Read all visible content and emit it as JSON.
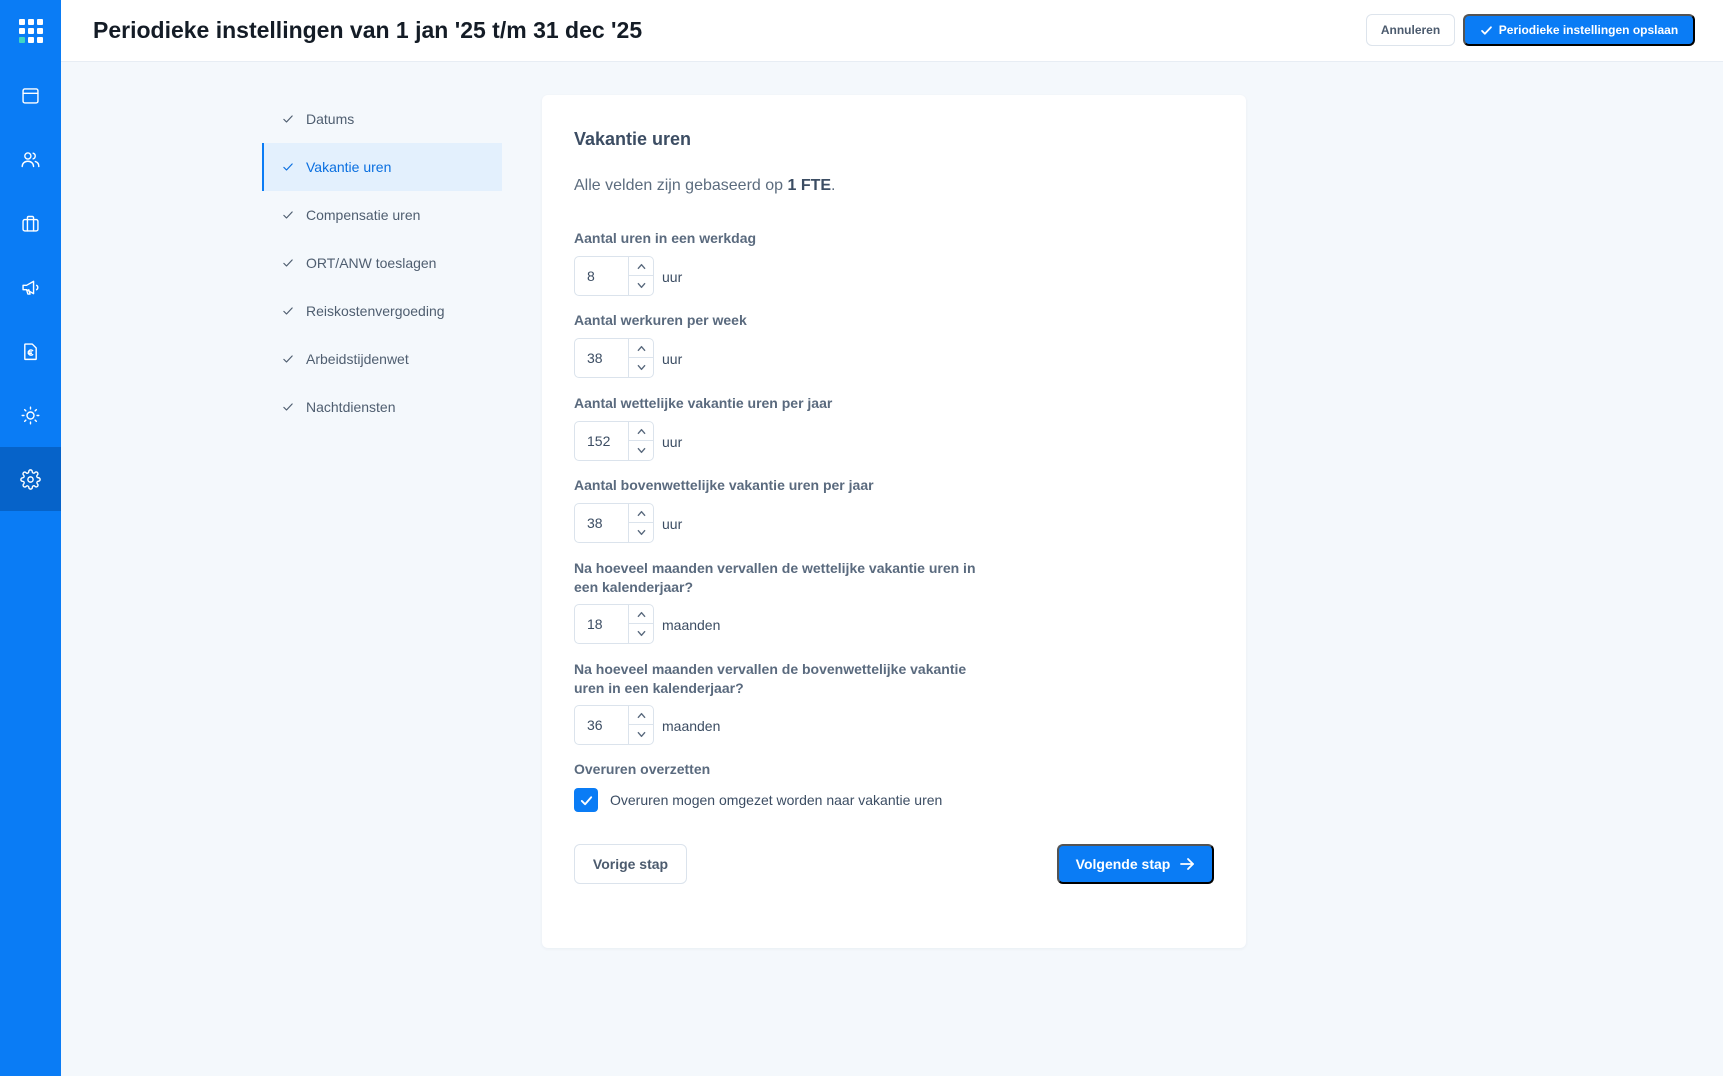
{
  "header": {
    "title": "Periodieke instellingen van 1 jan '25 t/m 31 dec '25",
    "cancel_label": "Annuleren",
    "save_label": "Periodieke instellingen opslaan"
  },
  "rail": {
    "items": [
      {
        "icon": "calendar-icon"
      },
      {
        "icon": "users-icon"
      },
      {
        "icon": "briefcase-icon"
      },
      {
        "icon": "megaphone-icon"
      },
      {
        "icon": "euro-document-icon"
      },
      {
        "icon": "sun-icon"
      },
      {
        "icon": "gear-icon",
        "active": true
      }
    ],
    "colors": {
      "background": "#0a7cf5",
      "active": "#0663c9"
    }
  },
  "steps": [
    {
      "label": "Datums"
    },
    {
      "label": "Vakantie uren",
      "active": true
    },
    {
      "label": "Compensatie uren"
    },
    {
      "label": "ORT/ANW toeslagen"
    },
    {
      "label": "Reiskostenvergoeding"
    },
    {
      "label": "Arbeidstijdenwet"
    },
    {
      "label": "Nachtdiensten"
    }
  ],
  "card": {
    "title": "Vakantie uren",
    "subtitle_prefix": "Alle velden zijn gebaseerd op ",
    "subtitle_bold": "1 FTE",
    "subtitle_suffix": ".",
    "fields": [
      {
        "label": "Aantal uren in een werkdag",
        "value": "8",
        "unit": "uur"
      },
      {
        "label": "Aantal werkuren per week",
        "value": "38",
        "unit": "uur"
      },
      {
        "label": "Aantal wettelijke vakantie uren per jaar",
        "value": "152",
        "unit": "uur"
      },
      {
        "label": "Aantal bovenwettelijke vakantie uren per jaar",
        "value": "38",
        "unit": "uur"
      },
      {
        "label": "Na hoeveel maanden vervallen de wettelijke vakantie uren in een kalenderjaar?",
        "value": "18",
        "unit": "maanden"
      },
      {
        "label": "Na hoeveel maanden vervallen de bovenwettelijke vakantie uren in een kalenderjaar?",
        "value": "36",
        "unit": "maanden"
      }
    ],
    "overuren": {
      "label": "Overuren overzetten",
      "checkbox_label": "Overuren mogen omgezet worden naar vakantie uren",
      "checked": true
    },
    "prev_label": "Vorige stap",
    "next_label": "Volgende stap"
  },
  "colors": {
    "accent": "#0a7cf5",
    "background": "#f4f8fc",
    "text": "#3c4d63"
  }
}
